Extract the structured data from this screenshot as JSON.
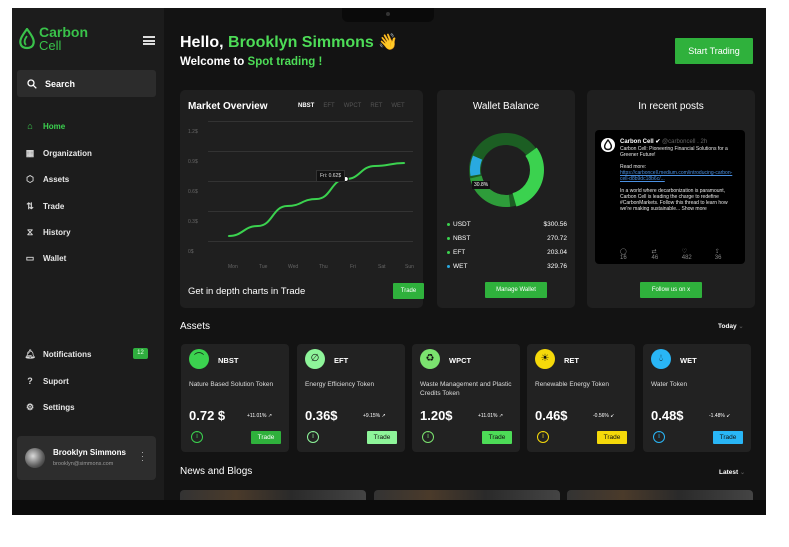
{
  "brand": {
    "line1": "Carbon",
    "line2": "Cell"
  },
  "sidebar": {
    "search_label": "Search",
    "items": [
      {
        "label": "Home",
        "icon": "home-icon"
      },
      {
        "label": "Organization",
        "icon": "organization-icon"
      },
      {
        "label": "Assets",
        "icon": "assets-icon"
      },
      {
        "label": "Trade",
        "icon": "trade-icon"
      },
      {
        "label": "History",
        "icon": "history-icon"
      },
      {
        "label": "Wallet",
        "icon": "wallet-icon"
      }
    ],
    "bottom_items": [
      {
        "label": "Notifications",
        "icon": "bell-icon"
      },
      {
        "label": "Suport",
        "icon": "help-icon"
      },
      {
        "label": "Settings",
        "icon": "gear-icon"
      }
    ],
    "notification_count": "12",
    "user": {
      "name": "Brooklyn Simmons",
      "email": "brooklyn@simmons.com"
    }
  },
  "header": {
    "greeting": "Hello,",
    "name": "Brooklyn Simmons",
    "emoji": "👋",
    "welcome_prefix": "Welcome to",
    "welcome_highlight": "Spot trading !",
    "start_button": "Start Trading"
  },
  "market": {
    "title": "Market Overview",
    "tabs": [
      "NBST",
      "EFT",
      "WPCT",
      "RET",
      "WET"
    ],
    "active_tab": "NBST",
    "tooltip": "Fri: 0.62$",
    "footer_text": "Get in depth charts in Trade",
    "trade_button": "Trade"
  },
  "chart_data": {
    "type": "line",
    "x": [
      "Mon",
      "Tue",
      "Wed",
      "Thu",
      "Fri",
      "Sat",
      "Sun"
    ],
    "y_ticks": [
      "1.2$",
      "0.9$",
      "0.6$",
      "0.3$",
      "0$"
    ],
    "ylim": [
      0,
      1.2
    ],
    "series": [
      {
        "values": [
          0.05,
          0.15,
          0.35,
          0.42,
          0.62,
          0.75,
          0.78
        ]
      }
    ],
    "highlight": {
      "x": "Fri",
      "y": 0.62
    }
  },
  "wallet": {
    "title": "Wallet Balance",
    "donut_label": "30.8%",
    "rows": [
      {
        "name": "USDT",
        "value": "$300.56",
        "color": "#3bd24f"
      },
      {
        "name": "NBST",
        "value": "270.72",
        "color": "#3bd24f"
      },
      {
        "name": "EFT",
        "value": "203.04",
        "color": "#3bd24f"
      },
      {
        "name": "WET",
        "value": "329.76",
        "color": "#29a9e0"
      }
    ],
    "manage_button": "Manage Wallet"
  },
  "posts": {
    "title": "In recent posts",
    "tweet": {
      "author": "Carbon Cell",
      "handle": "@carboncell . 2h",
      "text1": "Carbon Cell: Pioneering Financial Solutions for a Greener Future!",
      "read_more": "Read more:",
      "link": "https://carboncell.medium.com/introducing-carbon-cell-d8b9dc18b6c/...",
      "text2": "In a world where decarbonization is paramount, Carbon Cell is leading the charge to redefine #CarbonMarkets. Follow this thread to learn how we're making sustainable... Show more",
      "replies": "16",
      "retweets": "46",
      "likes": "482",
      "shares": "36"
    },
    "follow_button": "Follow us on x"
  },
  "assets_section": {
    "title": "Assets",
    "filter": "Today"
  },
  "assets": [
    {
      "symbol": "NBST",
      "name": "Nature Based Solution Token",
      "price": "0.72 $",
      "change": "+11.01% ↗",
      "color": "#3bd24f",
      "button": "Trade"
    },
    {
      "symbol": "EFT",
      "name": "Energy Efficiency Token",
      "price": "0.36$",
      "change": "+9.15% ↗",
      "color": "#8ef59a",
      "button": "Trade"
    },
    {
      "symbol": "WPCT",
      "name": "Waste Management and Plastic Credits Token",
      "price": "1.20$",
      "change": "+11.01% ↗",
      "color": "#7be36f",
      "button": "Trade"
    },
    {
      "symbol": "RET",
      "name": "Renewable Energy Token",
      "price": "0.46$",
      "change": "-0.56% ↙",
      "color": "#f5d90a",
      "button": "Trade"
    },
    {
      "symbol": "WET",
      "name": "Water Token",
      "price": "0.48$",
      "change": "-1.48% ↙",
      "color": "#29b6f6",
      "button": "Trade"
    }
  ],
  "news_section": {
    "title": "News and Blogs",
    "filter": "Latest"
  }
}
